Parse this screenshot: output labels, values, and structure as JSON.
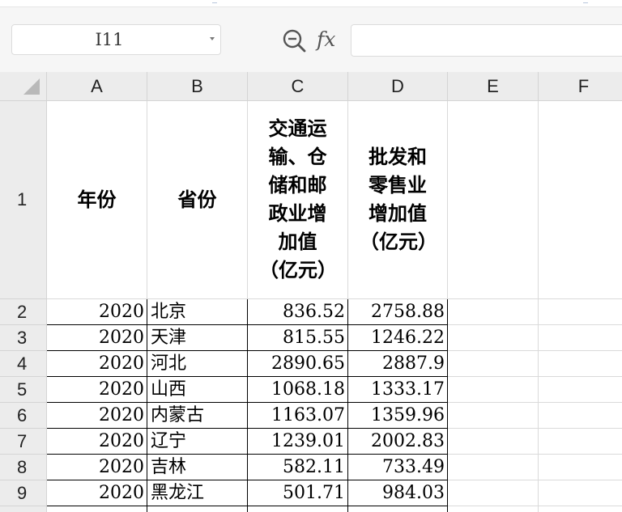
{
  "name_box": {
    "value": "I11"
  },
  "formula_bar": {
    "value": ""
  },
  "columns": [
    "A",
    "B",
    "C",
    "D",
    "E",
    "F"
  ],
  "rows": [
    "1",
    "2",
    "3",
    "4",
    "5",
    "6",
    "7",
    "8",
    "9"
  ],
  "header_row": {
    "a": "年份",
    "b": "省份",
    "c": "交通运输、仓储和邮政业增加值（亿元）",
    "d": "批发和零售业增加值（亿元）"
  },
  "data_rows": [
    {
      "year": "2020",
      "province": "北京",
      "transport": "836.52",
      "wholesale": "2758.88"
    },
    {
      "year": "2020",
      "province": "天津",
      "transport": "815.55",
      "wholesale": "1246.22"
    },
    {
      "year": "2020",
      "province": "河北",
      "transport": "2890.65",
      "wholesale": "2887.9"
    },
    {
      "year": "2020",
      "province": "山西",
      "transport": "1068.18",
      "wholesale": "1333.17"
    },
    {
      "year": "2020",
      "province": "内蒙古",
      "transport": "1163.07",
      "wholesale": "1359.96"
    },
    {
      "year": "2020",
      "province": "辽宁",
      "transport": "1239.01",
      "wholesale": "2002.83"
    },
    {
      "year": "2020",
      "province": "吉林",
      "transport": "582.11",
      "wholesale": "733.49"
    },
    {
      "year": "2020",
      "province": "黑龙江",
      "transport": "501.71",
      "wholesale": "984.03"
    }
  ],
  "colors": {
    "header_bg": "#ececec",
    "grid_line": "#dadada",
    "border": "#000000"
  }
}
